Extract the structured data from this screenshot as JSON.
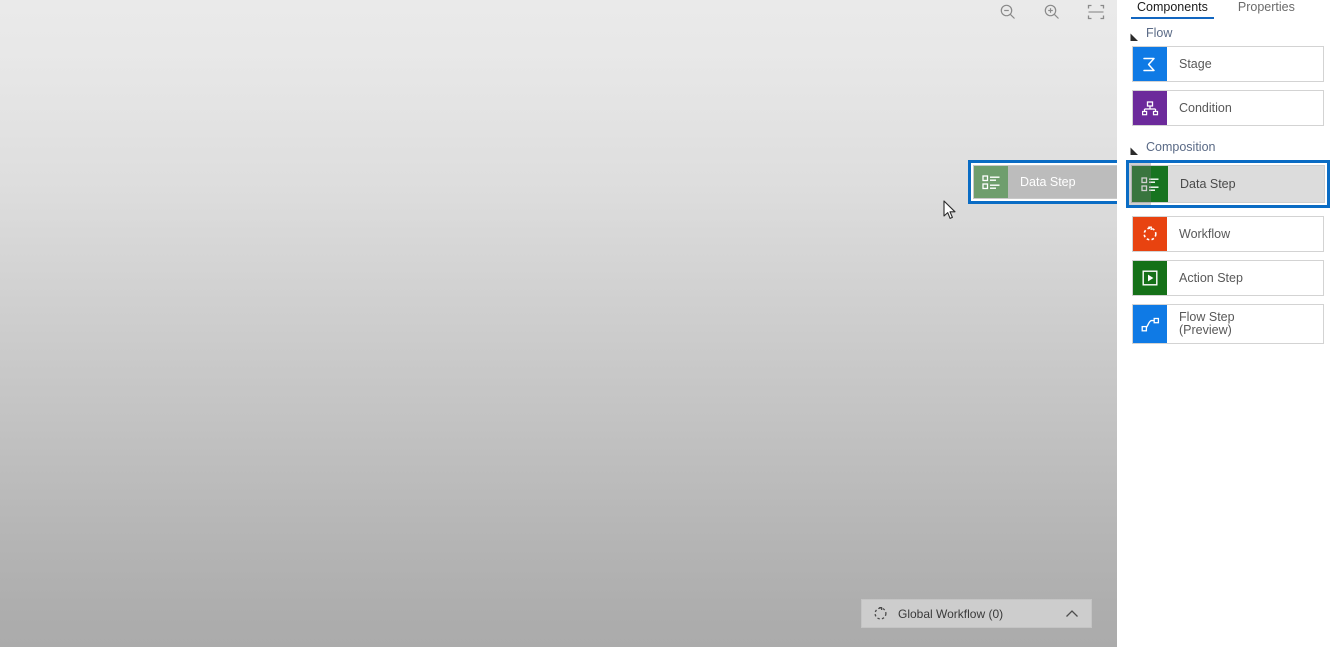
{
  "canvas": {
    "zoom_toolbar": [
      {
        "name": "zoom-out-icon",
        "label": "Zoom Out"
      },
      {
        "name": "zoom-in-icon",
        "label": "Zoom In"
      },
      {
        "name": "fit-to-screen-icon",
        "label": "Fit to Screen"
      }
    ],
    "drag_ghost": {
      "label": "Data Step",
      "icon": "data-step-icon"
    },
    "status_bar": {
      "icon": "workflow-circle-icon",
      "label": "Global Workflow (0)",
      "chevron": "chevron-up-icon"
    }
  },
  "sidebar": {
    "tabs": [
      {
        "label": "Components",
        "active": true
      },
      {
        "label": "Properties",
        "active": false
      }
    ],
    "groups": [
      {
        "title": "Flow",
        "items": [
          {
            "label": "Stage",
            "icon": "stage-icon",
            "tile": "blue",
            "highlighted": false
          },
          {
            "label": "Condition",
            "icon": "condition-icon",
            "tile": "purple",
            "highlighted": false
          }
        ]
      },
      {
        "title": "Composition",
        "items": [
          {
            "label": "Data Step",
            "icon": "data-step-icon",
            "tile": "green",
            "highlighted": true
          },
          {
            "label": "Workflow",
            "icon": "workflow-icon",
            "tile": "orange",
            "highlighted": false
          },
          {
            "label": "Action Step",
            "icon": "action-step-icon",
            "tile": "dgreen",
            "highlighted": false
          },
          {
            "label": "Flow Step\n(Preview)",
            "icon": "flow-step-icon",
            "tile": "flowblue",
            "highlighted": false
          }
        ]
      }
    ]
  },
  "colors": {
    "accent_blue": "#0a6cc4",
    "tab_underline": "#1266c0",
    "tile_blue": "#0f7ae5",
    "tile_purple": "#6c2a9b",
    "tile_green": "#177420",
    "tile_orange": "#e84310",
    "tile_dark_green": "#157118"
  }
}
